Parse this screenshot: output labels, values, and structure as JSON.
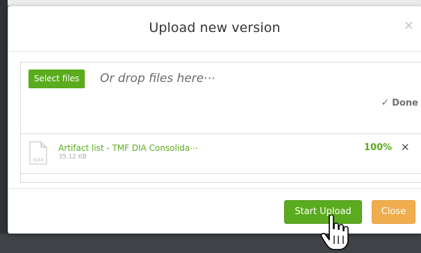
{
  "dialog": {
    "title": "Upload new version",
    "close_icon": "close-icon"
  },
  "dropzone": {
    "select_files_label": "Select files",
    "drop_hint": "Or drop files here⋯",
    "status_label": "Done",
    "status_icon": "checkmark-icon"
  },
  "files": [
    {
      "name": "Artifact list - TMF DIA Consolida⋯",
      "size": "35.12 KB",
      "type_label": "XLSX",
      "progress_text": "100%",
      "progress": 1.0,
      "remove_icon": "remove-icon"
    }
  ],
  "footer": {
    "start_upload_label": "Start Upload",
    "close_label": "Close"
  },
  "colors": {
    "accent_green": "#5aab1d",
    "close_orange": "#f0ad4e",
    "backdrop": "#3f4246"
  },
  "cursor": {
    "icon": "hand-pointer-icon"
  }
}
